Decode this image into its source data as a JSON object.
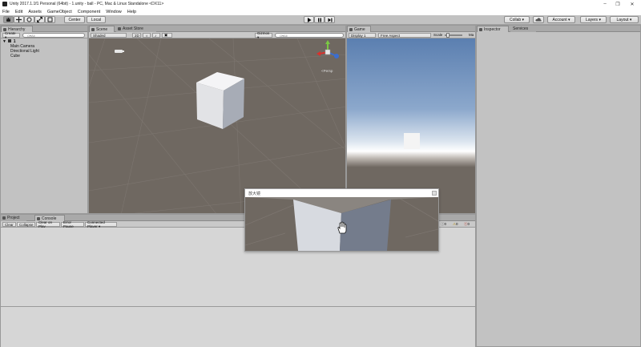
{
  "window": {
    "title": "Unity 2017.1.1f1 Personal (64bit) - 1.unity - ball - PC, Mac & Linux Standalone <DX11>",
    "minimize": "–",
    "maximize": "❐",
    "close": "✕"
  },
  "menu": [
    "File",
    "Edit",
    "Assets",
    "GameObject",
    "Component",
    "Window",
    "Help"
  ],
  "toolbar": {
    "center_label": "Center",
    "local_label": "Local",
    "collab_label": "Collab ▾",
    "account_label": "Account ▾",
    "layers_label": "Layers ▾",
    "layout_label": "Layout ▾"
  },
  "hierarchy": {
    "tab": "Hierarchy",
    "create_label": "Create ▾",
    "search_placeholder": "Q▾All",
    "scene_name": "1",
    "items": [
      "Main Camera",
      "Directional Light",
      "Cube"
    ]
  },
  "scene": {
    "tab_scene": "Scene",
    "tab_asset_store": "Asset Store",
    "shading": "Shaded",
    "mode_2d": "2D",
    "gizmos": "Gizmos ▾",
    "search_placeholder": "Q▾All",
    "persp_label": "<Persp"
  },
  "game": {
    "tab": "Game",
    "display": "Display 1",
    "aspect": "Free Aspect",
    "scale_label": "Scale",
    "maximize_label": "Ma"
  },
  "inspector": {
    "tab_inspector": "Inspector",
    "tab_services": "Services"
  },
  "console": {
    "tab_project": "Project",
    "tab_console": "Console",
    "buttons": [
      "Clear",
      "Collapse",
      "Clear on Play",
      "Error Pause",
      "Connected Player ▾"
    ],
    "counts": [
      "0",
      "0",
      "0"
    ]
  },
  "magnifier": {
    "title": "放大镜"
  },
  "colors": {
    "editor_bg": "#c2c2c2",
    "scene_ground": "#6f6861",
    "sky_top": "#5b7fb0"
  }
}
